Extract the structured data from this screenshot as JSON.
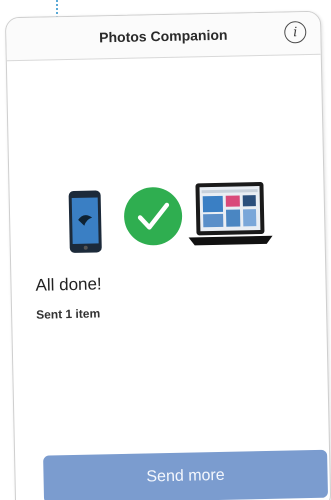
{
  "header": {
    "title": "Photos Companion",
    "info_icon": "info-icon",
    "info_glyph": "i"
  },
  "illustration": {
    "source_device_icon": "phone-icon",
    "status_icon": "checkmark-circle-icon",
    "target_device_icon": "laptop-icon",
    "check_color": "#2fae50"
  },
  "status": {
    "title": "All done!",
    "subtitle": "Sent 1 item"
  },
  "actions": {
    "send_more_label": "Send more"
  },
  "colors": {
    "button": "#7b9ccf",
    "accent_trail": "#5aa9d6"
  }
}
